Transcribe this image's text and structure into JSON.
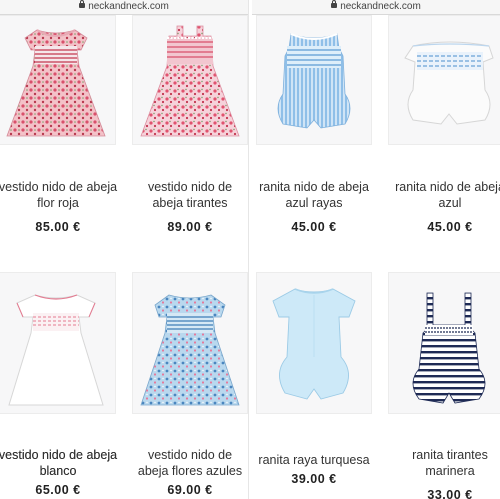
{
  "left_panel": {
    "url": "neckandneck.com",
    "products": [
      {
        "title": "vestido nido de abeja flor roja",
        "price": "85.00 €",
        "icon": "red-floral-dress"
      },
      {
        "title": "vestido nido de abeja tirantes",
        "price": "89.00 €",
        "icon": "pink-floral-sundress"
      },
      {
        "title": "vestido nido de abeja blanco",
        "price": "65.00 €",
        "icon": "white-dress"
      },
      {
        "title": "vestido nido de abeja flores azules",
        "price": "69.00 €",
        "icon": "blue-floral-dress"
      }
    ]
  },
  "right_panel": {
    "url": "neckandneck.com",
    "products": [
      {
        "title": "ranita nido de abeja azul rayas",
        "price": "45.00 €",
        "icon": "blue-striped-romper"
      },
      {
        "title": "ranita nido de abeja azul",
        "price": "45.00 €",
        "icon": "white-blue-romper"
      },
      {
        "title": "ranita raya turquesa",
        "price": "39.00 €",
        "icon": "turquoise-romper"
      },
      {
        "title": "ranita tirantes marinera",
        "price": "33.00 €",
        "icon": "navy-striped-romper"
      }
    ]
  },
  "colors": {
    "red_floral": "#e59aa8",
    "pink_floral": "#ec8fa3",
    "light_blue": "#a8cfee",
    "turquoise": "#c9e6f6",
    "navy": "#1e2a55"
  }
}
